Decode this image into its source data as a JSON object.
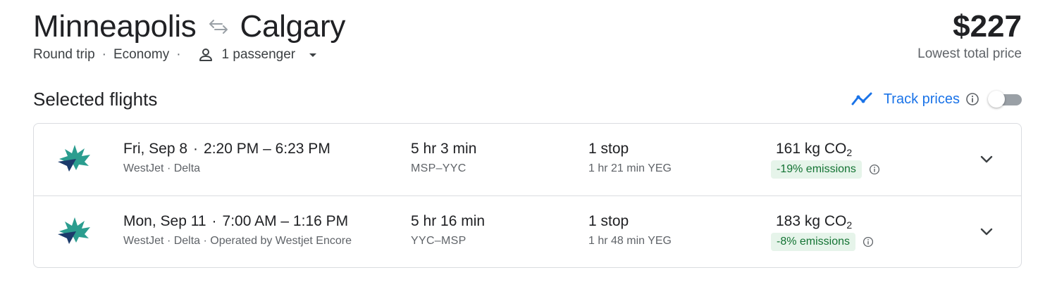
{
  "header": {
    "origin": "Minneapolis",
    "destination": "Calgary",
    "trip_type": "Round trip",
    "cabin_class": "Economy",
    "passengers": "1 passenger",
    "price": "$227",
    "price_label": "Lowest total price"
  },
  "section": {
    "title": "Selected flights",
    "track_prices_label": "Track prices",
    "track_prices_on": false
  },
  "flights": [
    {
      "date": "Fri, Sep 8",
      "time_range": "2:20 PM – 6:23 PM",
      "airlines": "WestJet · Delta",
      "duration": "5 hr 3 min",
      "airports": "MSP–YYC",
      "stops": "1 stop",
      "layover": "1 hr 21 min YEG",
      "co2_value": "161 kg CO",
      "co2_sub": "2",
      "emissions": "-19% emissions"
    },
    {
      "date": "Mon, Sep 11",
      "time_range": "7:00 AM – 1:16 PM",
      "airlines": "WestJet · Delta · Operated by Westjet Encore",
      "duration": "5 hr 16 min",
      "airports": "YYC–MSP",
      "stops": "1 stop",
      "layover": "1 hr 48 min YEG",
      "co2_value": "183 kg CO",
      "co2_sub": "2",
      "emissions": "-8% emissions"
    }
  ],
  "colors": {
    "accent": "#1a73e8",
    "emissions_bg": "#e6f4ea",
    "emissions_text": "#137333",
    "westjet_teal": "#2b9d8f",
    "westjet_navy": "#1b3a6b"
  },
  "icons": {
    "swap": "swap-arrows-icon",
    "passenger": "person-icon",
    "dropdown": "caret-down-icon",
    "track": "trend-line-icon",
    "info": "info-icon",
    "expand": "chevron-down-icon",
    "airline_logo": "westjet-logo-icon"
  }
}
